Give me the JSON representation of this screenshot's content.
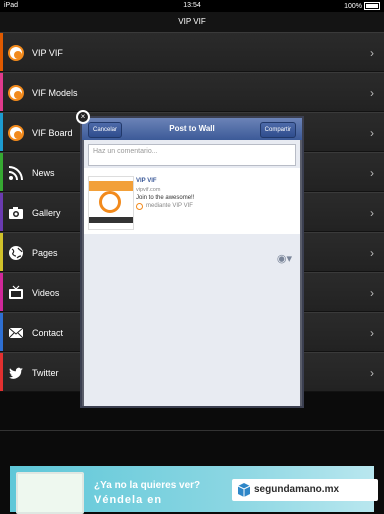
{
  "status": {
    "device": "iPad",
    "time": "13:54",
    "battery": "100%"
  },
  "nav": {
    "title": "VIP VIF"
  },
  "menu": [
    {
      "label": "VIP VIF",
      "icon": "vif-logo-icon",
      "color": "#e05a00"
    },
    {
      "label": "VIF Models",
      "icon": "vif-logo-icon",
      "color": "#e03a8c"
    },
    {
      "label": "VIF Board",
      "icon": "vif-logo-icon",
      "color": "#1d9bd0"
    },
    {
      "label": "News",
      "icon": "rss-icon",
      "color": "#36a832"
    },
    {
      "label": "Gallery",
      "icon": "camera-icon",
      "color": "#6a3bb0"
    },
    {
      "label": "Pages",
      "icon": "globe-icon",
      "color": "#d0c12a"
    },
    {
      "label": "Videos",
      "icon": "tv-icon",
      "color": "#d0289a"
    },
    {
      "label": "Contact",
      "icon": "mail-icon",
      "color": "#2e6fd2"
    },
    {
      "label": "Twitter",
      "icon": "twitter-icon",
      "color": "#e23030"
    }
  ],
  "dialog": {
    "title": "Post to Wall",
    "cancel_label": "Cancelar",
    "share_label": "Compartir",
    "comment_placeholder": "Haz un comentario...",
    "preview": {
      "title": "VIP VIF",
      "link": "vipvif.com",
      "description": "Join to the awesome!!",
      "via": "mediante VIP VIF"
    }
  },
  "ad": {
    "line1": "¿Ya no la quieres ver?",
    "line2": "Véndela en",
    "brand": "segundamano.mx"
  }
}
